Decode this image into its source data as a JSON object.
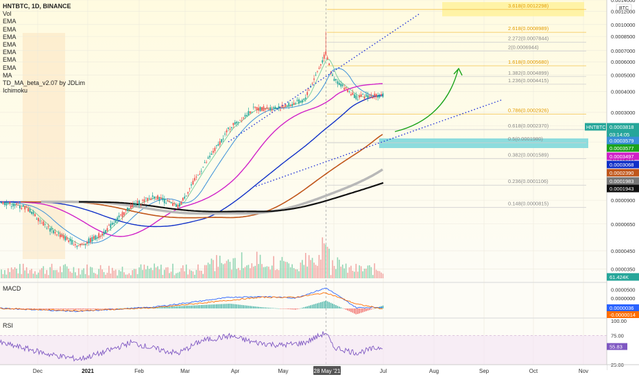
{
  "header": {
    "title": "HNTBTC, 1D, BINANCE",
    "indicators": [
      "Vol",
      "EMA",
      "EMA",
      "EMA",
      "EMA",
      "EMA",
      "EMA",
      "EMA",
      "MA",
      "TD_MA_beta_v2.07 by JDLim",
      "Ichimoku"
    ]
  },
  "currency_label": "BTC",
  "colors": {
    "bg_top": "#fffbe0",
    "bg_bottom": "#fdfcf6",
    "up": "#26a69a",
    "down": "#ef5350",
    "fib": "#888888",
    "fib_gold": "#f0a000",
    "channel": "#1d2ed8",
    "arrow": "#1aa31a"
  },
  "chart_data": [
    {
      "type": "line",
      "title": "HNTBTC, 1D, BINANCE",
      "xlabel": "",
      "ylabel": "",
      "yscale": "log",
      "ylim": [
        3e-05,
        0.0014
      ],
      "x_ticks": [
        "Dec",
        "2021",
        "Feb",
        "Mar",
        "Apr",
        "May",
        "28 May '21",
        "Jul",
        "Aug",
        "Sep",
        "Oct",
        "Nov"
      ],
      "y_ticks": [
        "0.0000350",
        "0.0000450",
        "0.0000650",
        "0.0000900",
        "0.0001200",
        "0.0001600",
        "0.0002000",
        "0.0002500",
        "0.0003000",
        "0.0004000",
        "0.0005000",
        "0.0006000",
        "0.0007000",
        "0.0008500",
        "0.0010000",
        "0.0012000",
        "0.0014000"
      ],
      "price_series": {
        "x": [
          "Nov 15",
          "Dec 1",
          "Dec 15",
          "Jan 1",
          "Jan 15",
          "Feb 1",
          "Feb 15",
          "Mar 1",
          "Mar 15",
          "Apr 1",
          "Apr 15",
          "May 1",
          "May 15",
          "May 28",
          "Jun 1",
          "Jun 15",
          "Jul 1"
        ],
        "close": [
          8.8e-05,
          8.1e-05,
          6e-05,
          4.8e-05,
          5.7e-05,
          8.3e-05,
          9.5e-05,
          8.2e-05,
          0.000138,
          0.000245,
          0.000315,
          0.00032,
          0.000355,
          0.00068,
          0.00048,
          0.00037,
          0.0003818
        ]
      },
      "fib_levels": [
        {
          "label": "3.618(0.0012298)",
          "value": 0.0012298
        },
        {
          "label": "2.618(0.0008989)",
          "value": 0.0008989
        },
        {
          "label": "2.272(0.0007844)",
          "value": 0.0007844
        },
        {
          "label": "2(0.0006944)",
          "value": 0.0006944
        },
        {
          "label": "1.618(0.0005680)",
          "value": 0.000568
        },
        {
          "label": "1.382(0.0004899)",
          "value": 0.0004899
        },
        {
          "label": "1.236(0.0004415)",
          "value": 0.0004415
        },
        {
          "label": "0.786(0.0002926)",
          "value": 0.0002926
        },
        {
          "label": "0.618(0.0002370)",
          "value": 0.000237
        },
        {
          "label": "0.5(0.0001980)",
          "value": 0.000198
        },
        {
          "label": "0.382(0.0001589)",
          "value": 0.0001589
        },
        {
          "label": "0.236(0.0001106)",
          "value": 0.0001106
        },
        {
          "label": "0.148(0.0000815)",
          "value": 8.15e-05
        }
      ],
      "price_labels": [
        {
          "text": "HNTBTC",
          "value": "0.0003818",
          "color": "#26a69a"
        },
        {
          "text": "",
          "value": "03:14:05",
          "color": "#26a69a"
        },
        {
          "text": "",
          "value": "0.0003579",
          "color": "#3a8fd8"
        },
        {
          "text": "",
          "value": "0.0003577",
          "color": "#1aa31a"
        },
        {
          "text": "",
          "value": "0.0003497",
          "color": "#d020c8"
        },
        {
          "text": "",
          "value": "0.0003068",
          "color": "#1030c8"
        },
        {
          "text": "",
          "value": "0.0002390",
          "color": "#c0561a"
        },
        {
          "text": "",
          "value": "0.0001983",
          "color": "#777777"
        },
        {
          "text": "",
          "value": "0.0001943",
          "color": "#111111"
        },
        {
          "text": "",
          "value": "61.424K",
          "color": "#26a69a"
        }
      ]
    },
    {
      "type": "line",
      "title": "MACD",
      "y_ticks": [
        "0.0000500",
        "0.0000000"
      ],
      "series": [
        {
          "name": "MACD",
          "x": [
            "Nov 15",
            "Jan 1",
            "Feb 15",
            "Apr 1",
            "Apr 20",
            "May 10",
            "May 28",
            "Jun 15",
            "Jul 1"
          ],
          "values": [
            5e-07,
            -8e-06,
            4e-06,
            3e-05,
            3.2e-05,
            2.8e-05,
            5.5e-05,
            2e-06,
            3.6e-06
          ]
        },
        {
          "name": "Signal",
          "x": [
            "Nov 15",
            "Jan 1",
            "Feb 15",
            "Apr 1",
            "Apr 20",
            "May 10",
            "May 28",
            "Jun 15",
            "Jul 1"
          ],
          "values": [
            3e-07,
            -6e-06,
            2e-06,
            2.2e-05,
            3e-05,
            3e-05,
            4.2e-05,
            1.2e-05,
            -1.4e-06
          ]
        }
      ],
      "labels": [
        "0.0000036",
        "-0.0000014"
      ]
    },
    {
      "type": "line",
      "title": "RSI",
      "y_ticks": [
        "100.00",
        "75.00",
        "25.00"
      ],
      "series": [
        {
          "name": "RSI",
          "x": [
            "Nov 15",
            "Dec 1",
            "Dec 15",
            "Jan 1",
            "Jan 15",
            "Feb 1",
            "Feb 15",
            "Mar 1",
            "Mar 15",
            "Apr 1",
            "Apr 15",
            "May 1",
            "May 15",
            "May 28",
            "Jun 1",
            "Jun 15",
            "Jul 1"
          ],
          "values": [
            62,
            52,
            42,
            34,
            45,
            63,
            52,
            44,
            66,
            74,
            63,
            58,
            62,
            80,
            55,
            45,
            55.83
          ]
        }
      ],
      "label": "55.83"
    }
  ]
}
